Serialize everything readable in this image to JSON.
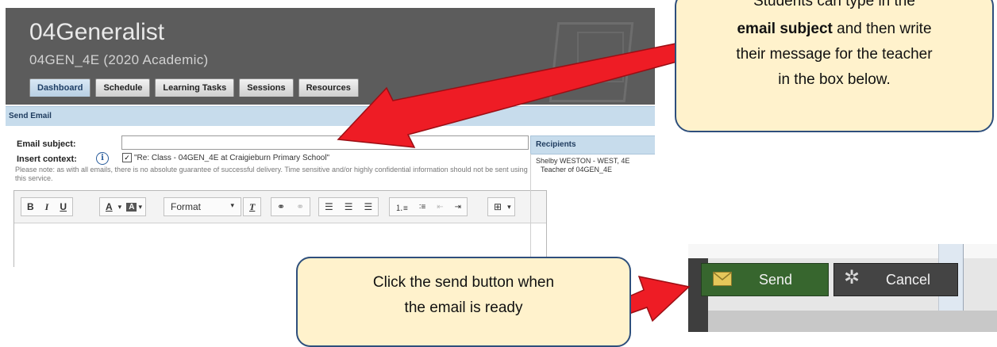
{
  "course": {
    "title": "04Generalist",
    "subtitle": "04GEN_4E (2020 Academic)",
    "tabs": [
      "Dashboard",
      "Schedule",
      "Learning Tasks",
      "Sessions",
      "Resources"
    ]
  },
  "send_email": {
    "panel_title": "Send Email",
    "subject_label": "Email subject:",
    "subject_value": "",
    "context_label": "Insert context:",
    "context_checked": true,
    "context_text": "\"Re: Class - 04GEN_4E at Craigieburn Primary School\"",
    "note": "Please note: as with all emails, there is no absolute guarantee of successful delivery. Time sensitive and/or highly confidential information should not be sent using this service."
  },
  "toolbar": {
    "bold": "B",
    "italic": "I",
    "underline": "U",
    "text_color": "A",
    "bg_color": "A",
    "format": "Format",
    "clear_format": "T",
    "dropdown_caret": "▾"
  },
  "recipients": {
    "header": "Recipients",
    "name": "Shelby WESTON - WEST, 4E",
    "role": "Teacher of 04GEN_4E"
  },
  "actions": {
    "send": "Send",
    "cancel": "Cancel"
  },
  "callouts": {
    "top": {
      "line1": "Students can type in the",
      "bold": "email subject",
      "line2_rest": " and then write",
      "line3": "their message for the teacher",
      "line4": "in the box below."
    },
    "bottom": {
      "line1": "Click the send button when",
      "line2": "the email is ready"
    }
  },
  "colors": {
    "header_bg": "#5c5c5c",
    "panel_blue": "#c7dcec",
    "send_green": "#37662e",
    "cancel_dark": "#444444",
    "callout_fill": "#fff2cc",
    "callout_border": "#2e4f7c",
    "arrow_red": "#ee1c25"
  }
}
